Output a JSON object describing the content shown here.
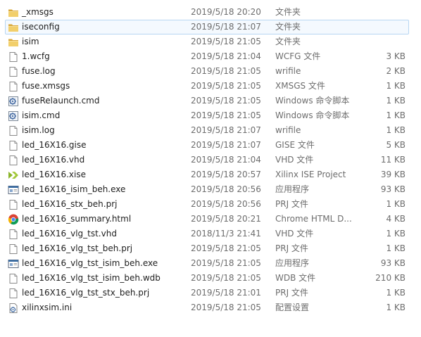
{
  "rows": [
    {
      "name": "_xmsgs",
      "date": "2019/5/18 20:20",
      "type": "文件夹",
      "size": "",
      "icon": "folder-icon",
      "selected": false
    },
    {
      "name": "iseconfig",
      "date": "2019/5/18 21:07",
      "type": "文件夹",
      "size": "",
      "icon": "folder-icon",
      "selected": true
    },
    {
      "name": "isim",
      "date": "2019/5/18 21:05",
      "type": "文件夹",
      "size": "",
      "icon": "folder-icon",
      "selected": false
    },
    {
      "name": "1.wcfg",
      "date": "2019/5/18 21:04",
      "type": "WCFG 文件",
      "size": "3 KB",
      "icon": "document-icon",
      "selected": false
    },
    {
      "name": "fuse.log",
      "date": "2019/5/18 21:05",
      "type": "wrifile",
      "size": "2 KB",
      "icon": "document-icon",
      "selected": false
    },
    {
      "name": "fuse.xmsgs",
      "date": "2019/5/18 21:05",
      "type": "XMSGS 文件",
      "size": "1 KB",
      "icon": "document-icon",
      "selected": false
    },
    {
      "name": "fuseRelaunch.cmd",
      "date": "2019/5/18 21:05",
      "type": "Windows 命令脚本",
      "size": "1 KB",
      "icon": "gear-script-icon",
      "selected": false
    },
    {
      "name": "isim.cmd",
      "date": "2019/5/18 21:05",
      "type": "Windows 命令脚本",
      "size": "1 KB",
      "icon": "gear-script-icon",
      "selected": false
    },
    {
      "name": "isim.log",
      "date": "2019/5/18 21:07",
      "type": "wrifile",
      "size": "1 KB",
      "icon": "document-icon",
      "selected": false
    },
    {
      "name": "led_16X16.gise",
      "date": "2019/5/18 21:07",
      "type": "GISE 文件",
      "size": "5 KB",
      "icon": "document-icon",
      "selected": false
    },
    {
      "name": "led_16X16.vhd",
      "date": "2019/5/18 21:04",
      "type": "VHD 文件",
      "size": "11 KB",
      "icon": "document-icon",
      "selected": false
    },
    {
      "name": "led_16X16.xise",
      "date": "2019/5/18 20:57",
      "type": "Xilinx ISE Project",
      "size": "39 KB",
      "icon": "xilinx-icon",
      "selected": false
    },
    {
      "name": "led_16X16_isim_beh.exe",
      "date": "2019/5/18 20:56",
      "type": "应用程序",
      "size": "93 KB",
      "icon": "application-icon",
      "selected": false
    },
    {
      "name": "led_16X16_stx_beh.prj",
      "date": "2019/5/18 20:56",
      "type": "PRJ 文件",
      "size": "1 KB",
      "icon": "document-icon",
      "selected": false
    },
    {
      "name": "led_16X16_summary.html",
      "date": "2019/5/18 20:21",
      "type": "Chrome HTML D...",
      "size": "4 KB",
      "icon": "chrome-icon",
      "selected": false
    },
    {
      "name": "led_16X16_vlg_tst.vhd",
      "date": "2018/11/3 21:41",
      "type": "VHD 文件",
      "size": "1 KB",
      "icon": "document-icon",
      "selected": false
    },
    {
      "name": "led_16X16_vlg_tst_beh.prj",
      "date": "2019/5/18 21:05",
      "type": "PRJ 文件",
      "size": "1 KB",
      "icon": "document-icon",
      "selected": false
    },
    {
      "name": "led_16X16_vlg_tst_isim_beh.exe",
      "date": "2019/5/18 21:05",
      "type": "应用程序",
      "size": "93 KB",
      "icon": "application-icon",
      "selected": false
    },
    {
      "name": "led_16X16_vlg_tst_isim_beh.wdb",
      "date": "2019/5/18 21:05",
      "type": "WDB 文件",
      "size": "210 KB",
      "icon": "document-icon",
      "selected": false
    },
    {
      "name": "led_16X16_vlg_tst_stx_beh.prj",
      "date": "2019/5/18 21:01",
      "type": "PRJ 文件",
      "size": "1 KB",
      "icon": "document-icon",
      "selected": false
    },
    {
      "name": "xilinxsim.ini",
      "date": "2019/5/18 21:05",
      "type": "配置设置",
      "size": "1 KB",
      "icon": "settings-file-icon",
      "selected": false
    }
  ],
  "colors": {
    "selection_border": "#b7d6f2",
    "selection_fill": "#f4f9fe",
    "secondary_text": "#6d6d6d",
    "folder": "#e8c15a"
  }
}
